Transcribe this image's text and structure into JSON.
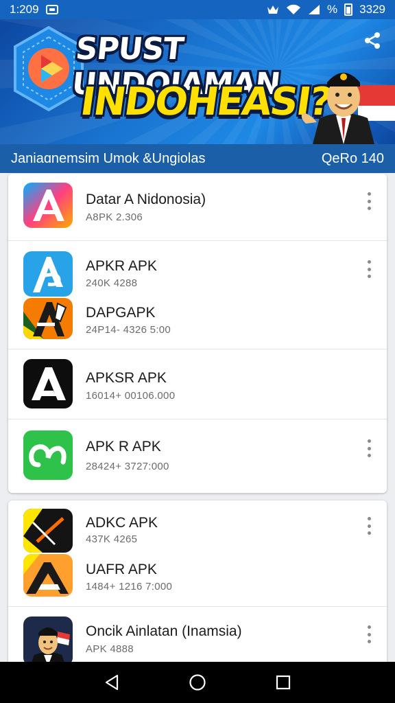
{
  "status_bar": {
    "time": "1:209",
    "battery_text": "% ",
    "right_time": "3329"
  },
  "banner": {
    "title_line1": "SPUST UNDOIAMAN",
    "title_line2": "INDOHEASI?"
  },
  "subtitle_bar": {
    "left": "Janiaɑnemsim Umok &Ungiolas",
    "right": "QeRo 140"
  },
  "apps": [
    {
      "name": "Datar A Nidonosia)",
      "sub": "A8PK 2.306",
      "icon": "apk-a-gradient-icon"
    },
    {
      "name": "APKR APK",
      "sub": "240K 4288",
      "icon": "apk-blue-a-icon"
    },
    {
      "name": "DAPGAPK",
      "sub": "24P14- 4326 5:00",
      "icon": "apk-orange-a-icon"
    },
    {
      "name": "APKSR APK",
      "sub": "16014+ 00106.000",
      "icon": "apk-black-a-icon"
    },
    {
      "name": "APK R APK",
      "sub": "28424+ 3727:000",
      "icon": "apk-green-icon"
    },
    {
      "name": "ADKC APK",
      "sub": "437K 4265",
      "icon": "apk-yellow-black-icon"
    },
    {
      "name": "UAFR APK",
      "sub": "1484+ 1216 7:000",
      "icon": "apk-orange-mountain-icon"
    },
    {
      "name": "Oncik Ainlatan (Inamsia)",
      "sub": "APK 4888",
      "icon": "apk-avatar-icon"
    }
  ],
  "colors": {
    "header_blue": "#1565c0",
    "subbar_blue": "#1a5fa8",
    "title_yellow": "#ffe000"
  },
  "nav": {
    "back": "back-icon",
    "home": "home-icon",
    "recents": "recents-icon"
  }
}
